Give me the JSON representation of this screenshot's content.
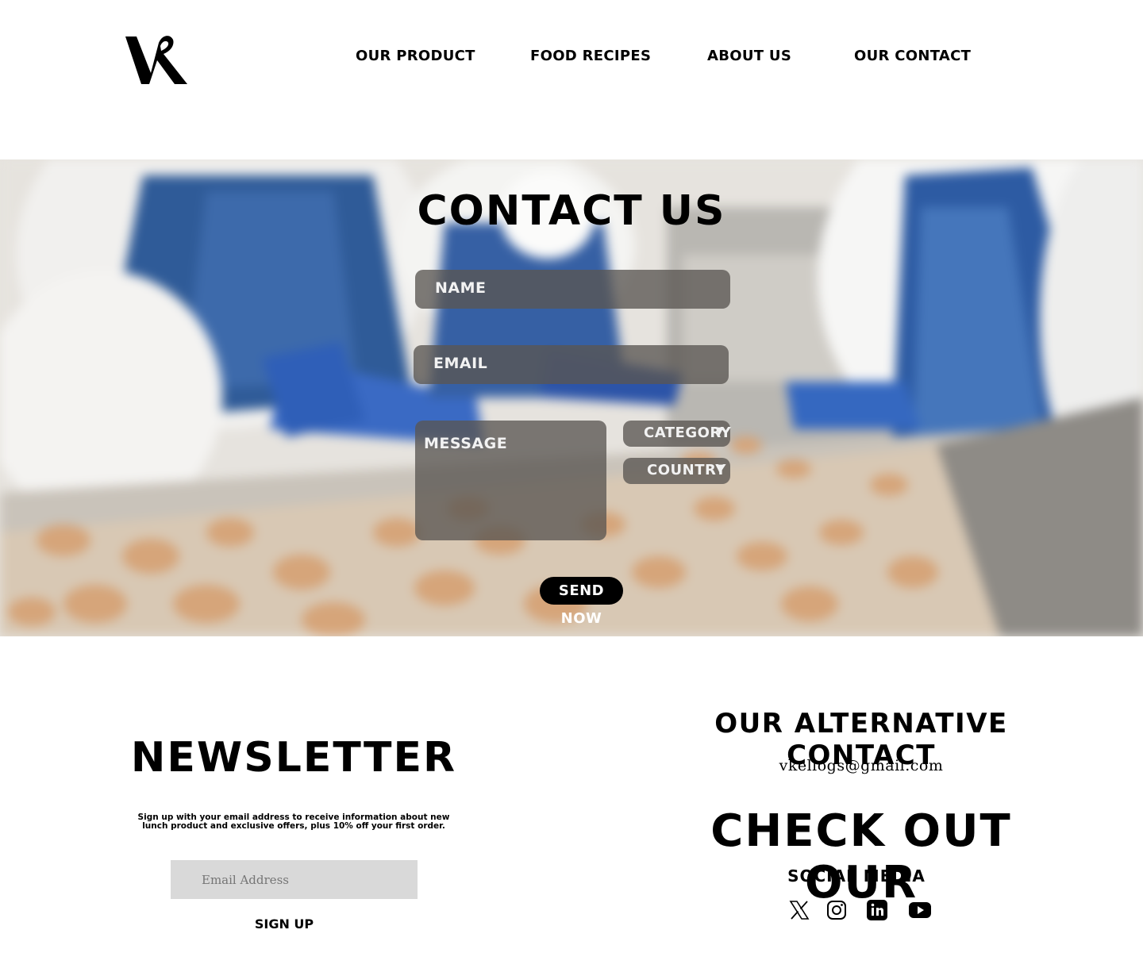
{
  "nav": {
    "items": [
      {
        "label": "OUR PRODUCT"
      },
      {
        "label": "FOOD RECIPES"
      },
      {
        "label": "ABOUT US"
      },
      {
        "label": "OUR CONTACT"
      }
    ]
  },
  "contact": {
    "title": "CONTACT US",
    "name_placeholder": "NAME",
    "email_placeholder": "EMAIL",
    "message_placeholder": "MESSAGE",
    "category_label": "CATEGORY",
    "country_label": "COUNTRY",
    "send_label": "SEND NOW"
  },
  "newsletter": {
    "title": "NEWSLETTER",
    "text": "Sign up with your email address to receive information about new lunch product and exclusive offers, plus 10% off your first order.",
    "email_placeholder": "Email Address",
    "signup_label": "SIGN UP"
  },
  "alt_contact": {
    "title": "OUR ALTERNATIVE CONTACT",
    "email": "vkellogs@gmail.com"
  },
  "social": {
    "title": "CHECK OUT OUR",
    "subtitle": "SOCIAL MEDIA",
    "icons": [
      "x-icon",
      "instagram-icon",
      "linkedin-icon",
      "youtube-icon"
    ]
  }
}
